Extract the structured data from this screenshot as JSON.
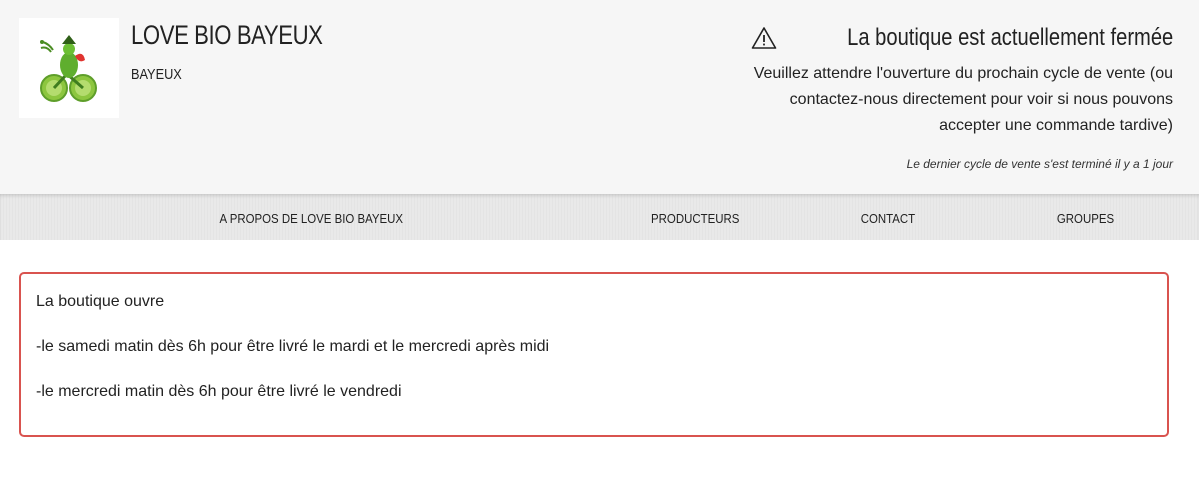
{
  "header": {
    "shop_name": "LOVE BIO BAYEUX",
    "city": "BAYEUX",
    "logo_icon": "cyclist-frog-logo",
    "status_icon": "warning-triangle-icon",
    "status_title": "La boutique est actuellement fermée",
    "status_message": "Veuillez attendre l'ouverture du prochain cycle de vente (ou contactez-nous directement pour voir si nous pouvons accepter une commande tardive)",
    "last_cycle_note": "Le dernier cycle de vente s'est terminé il y a 1 jour"
  },
  "nav": {
    "items": [
      {
        "label": "A PROPOS DE LOVE BIO BAYEUX"
      },
      {
        "label": "PRODUCTEURS"
      },
      {
        "label": "CONTACT"
      },
      {
        "label": "GROUPES"
      }
    ]
  },
  "notice": {
    "lines": [
      "La boutique ouvre",
      "-le samedi matin dès 6h pour être livré le mardi et le mercredi après midi",
      "-le mercredi matin dès 6h pour être livré le vendredi"
    ],
    "border_color": "#d9534f"
  }
}
